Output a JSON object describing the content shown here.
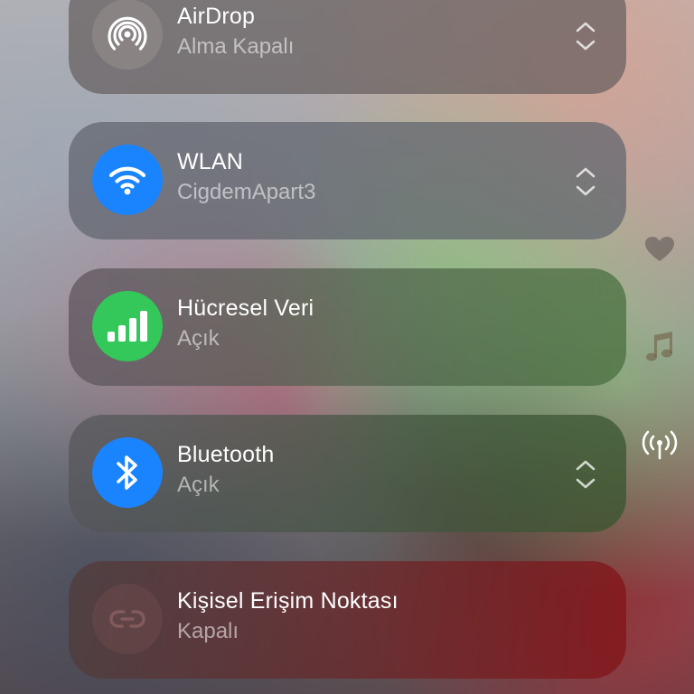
{
  "tiles": {
    "airdrop": {
      "title": "AirDrop",
      "status": "Alma Kapalı",
      "icon": "airdrop-icon"
    },
    "wlan": {
      "title": "WLAN",
      "status": "CigdemApart3",
      "icon": "wifi-icon"
    },
    "cellular": {
      "title": "Hücresel Veri",
      "status": "Açık",
      "icon": "cellular-signal-icon"
    },
    "bluetooth": {
      "title": "Bluetooth",
      "status": "Açık",
      "icon": "bluetooth-icon"
    },
    "hotspot": {
      "title": "Kişisel Erişim Noktası",
      "status": "Kapalı",
      "icon": "personal-hotspot-icon"
    }
  },
  "side_icons": [
    "heart-icon",
    "music-note-icon",
    "wireless-antenna-icon"
  ],
  "colors": {
    "blue": "#1a84ff",
    "green": "#34c759"
  }
}
